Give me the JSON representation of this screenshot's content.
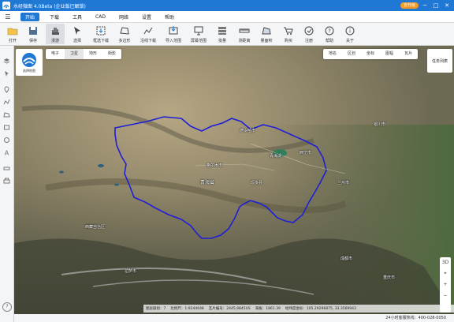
{
  "window": {
    "title": "水经微图 4.0Beta (企业版已解锁)",
    "upgrade_badge": "去升级",
    "minimize": "─",
    "maximize": "□",
    "close": "✕"
  },
  "menu": [
    "开始",
    "下载",
    "工具",
    "CAD",
    "网络",
    "设置",
    "帮助"
  ],
  "menu_active_index": 0,
  "toolbar": [
    {
      "label": "打开",
      "icon": "folder-open-icon"
    },
    {
      "label": "保存",
      "icon": "save-icon"
    },
    {
      "label": "漫游",
      "icon": "hand-pan-icon"
    },
    {
      "label": "选择",
      "icon": "select-arrow-icon"
    },
    {
      "label": "框选下载",
      "icon": "box-download-icon"
    },
    {
      "label": "多边形",
      "icon": "polygon-icon"
    },
    {
      "label": "沿线下载",
      "icon": "line-download-icon"
    },
    {
      "label": "导入范围",
      "icon": "import-range-icon"
    },
    {
      "label": "屏幕范围",
      "icon": "screen-range-icon"
    },
    {
      "label": "批量",
      "icon": "batch-icon"
    },
    {
      "label": "测距离",
      "icon": "measure-distance-icon"
    },
    {
      "label": "量面积",
      "icon": "measure-area-icon"
    },
    {
      "label": "购买",
      "icon": "cart-icon"
    },
    {
      "label": "注册",
      "icon": "register-icon"
    },
    {
      "label": "帮助",
      "icon": "help-icon"
    },
    {
      "label": "关于",
      "icon": "about-icon"
    }
  ],
  "toolbar_active_index": 2,
  "map": {
    "logo_text": "选择地图",
    "source_tabs": [
      "电子",
      "卫星",
      "地形",
      "街影"
    ],
    "source_active_index": 1,
    "right_tabs": [
      "地名",
      "区划",
      "坐标",
      "图幅",
      "瓦片"
    ],
    "task_list": "任务列表",
    "controls": [
      "3D",
      "⌖",
      "+",
      "−"
    ],
    "region_name": "青海省",
    "place_labels": [
      {
        "text": "西宁市"
      },
      {
        "text": "青海湖"
      },
      {
        "text": "格尔木市"
      },
      {
        "text": "玛多县"
      },
      {
        "text": "兰州市"
      },
      {
        "text": "成都市"
      },
      {
        "text": "银川市"
      },
      {
        "text": "拉萨市"
      },
      {
        "text": "西藏自治区"
      },
      {
        "text": "德令哈市"
      },
      {
        "text": "重庆市"
      }
    ],
    "status": {
      "zoom": "图层级别：7",
      "scale": "比例尺：1:9244648",
      "tile_info": "瓦片编号：2445,9845US",
      "elevation": "海拔：1861.39",
      "coords": "经纬度坐标：105.29296875, 33.3569943"
    },
    "hotline": "24小时客服热线：400-028-0050"
  },
  "colors": {
    "titlebar": "#1f78d4",
    "boundary": "#1f1fd6",
    "accent": "#1f78d4"
  }
}
